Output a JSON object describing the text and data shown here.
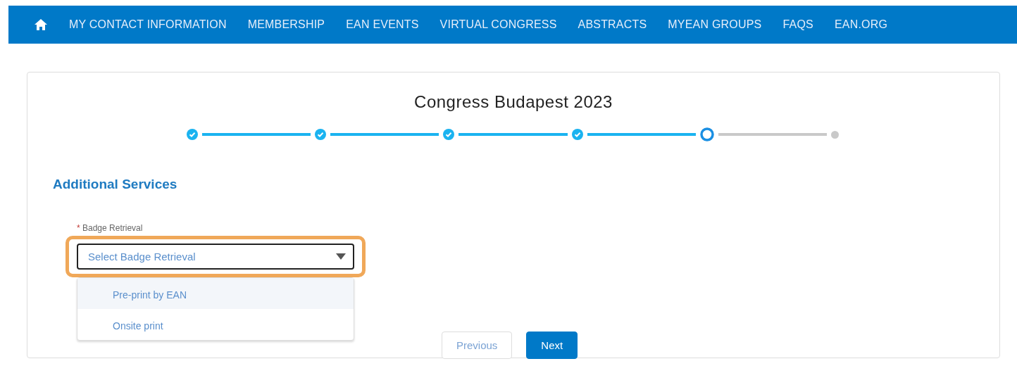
{
  "nav": {
    "items": [
      {
        "label": "MY CONTACT INFORMATION"
      },
      {
        "label": "MEMBERSHIP"
      },
      {
        "label": "EAN EVENTS"
      },
      {
        "label": "VIRTUAL CONGRESS"
      },
      {
        "label": "ABSTRACTS"
      },
      {
        "label": "MYEAN GROUPS"
      },
      {
        "label": "FAQS"
      },
      {
        "label": "EAN.ORG"
      }
    ]
  },
  "title": "Congress Budapest 2023",
  "steps": [
    {
      "completed": true,
      "current": false
    },
    {
      "completed": true,
      "current": false
    },
    {
      "completed": true,
      "current": false
    },
    {
      "completed": true,
      "current": false
    },
    {
      "completed": false,
      "current": true
    },
    {
      "completed": false,
      "current": false
    }
  ],
  "section_title": "Additional Services",
  "field": {
    "label": "Badge Retrieval",
    "required_mark": "*",
    "placeholder": "Select Badge Retrieval",
    "expanded": true,
    "highlighted": true,
    "options": [
      {
        "label": "Pre-print by EAN",
        "selected": true
      },
      {
        "label": "Onsite print",
        "selected": false
      }
    ]
  },
  "buttons": [
    {
      "label": "Previous",
      "kind": "secondary"
    },
    {
      "label": "Next",
      "kind": "primary"
    }
  ]
}
